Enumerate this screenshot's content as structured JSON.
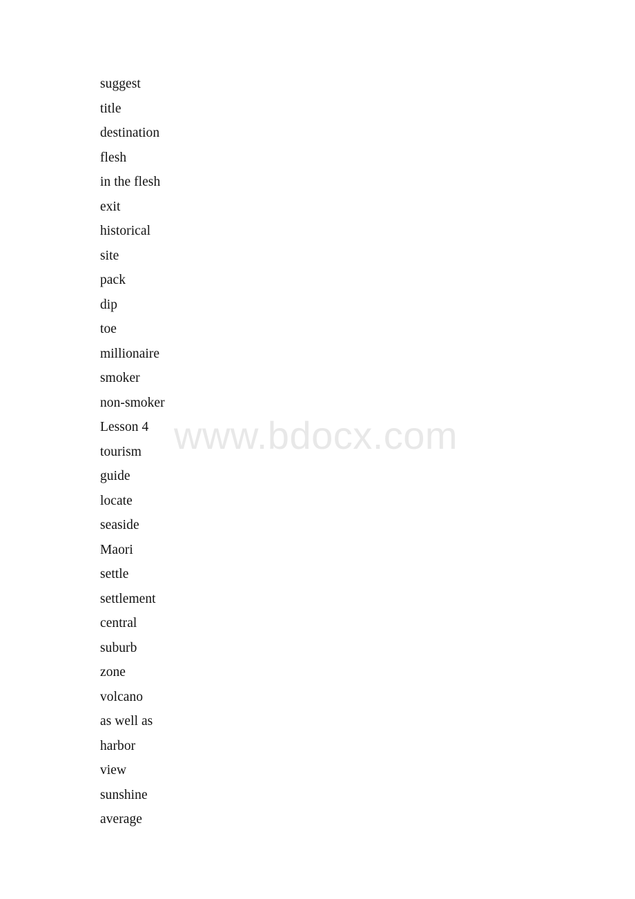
{
  "page": {
    "background_color": "#ffffff",
    "text_color": "#131313"
  },
  "watermark": {
    "text": "www.bdocx.com",
    "color": "#e8e8e8"
  },
  "word_list": {
    "items": [
      {
        "text": "suggest"
      },
      {
        "text": "title"
      },
      {
        "text": "destination"
      },
      {
        "text": "flesh"
      },
      {
        "text": "in the flesh"
      },
      {
        "text": "exit"
      },
      {
        "text": "historical"
      },
      {
        "text": "site"
      },
      {
        "text": "pack"
      },
      {
        "text": "dip"
      },
      {
        "text": "toe"
      },
      {
        "text": "millionaire"
      },
      {
        "text": "smoker"
      },
      {
        "text": "non-smoker"
      },
      {
        "text": "Lesson 4"
      },
      {
        "text": "tourism"
      },
      {
        "text": "guide"
      },
      {
        "text": "locate"
      },
      {
        "text": "seaside"
      },
      {
        "text": "Maori"
      },
      {
        "text": "settle"
      },
      {
        "text": "settlement"
      },
      {
        "text": "central"
      },
      {
        "text": "suburb"
      },
      {
        "text": "zone"
      },
      {
        "text": "volcano"
      },
      {
        "text": "as well as"
      },
      {
        "text": "harbor"
      },
      {
        "text": "view"
      },
      {
        "text": "sunshine"
      },
      {
        "text": "average"
      }
    ]
  }
}
